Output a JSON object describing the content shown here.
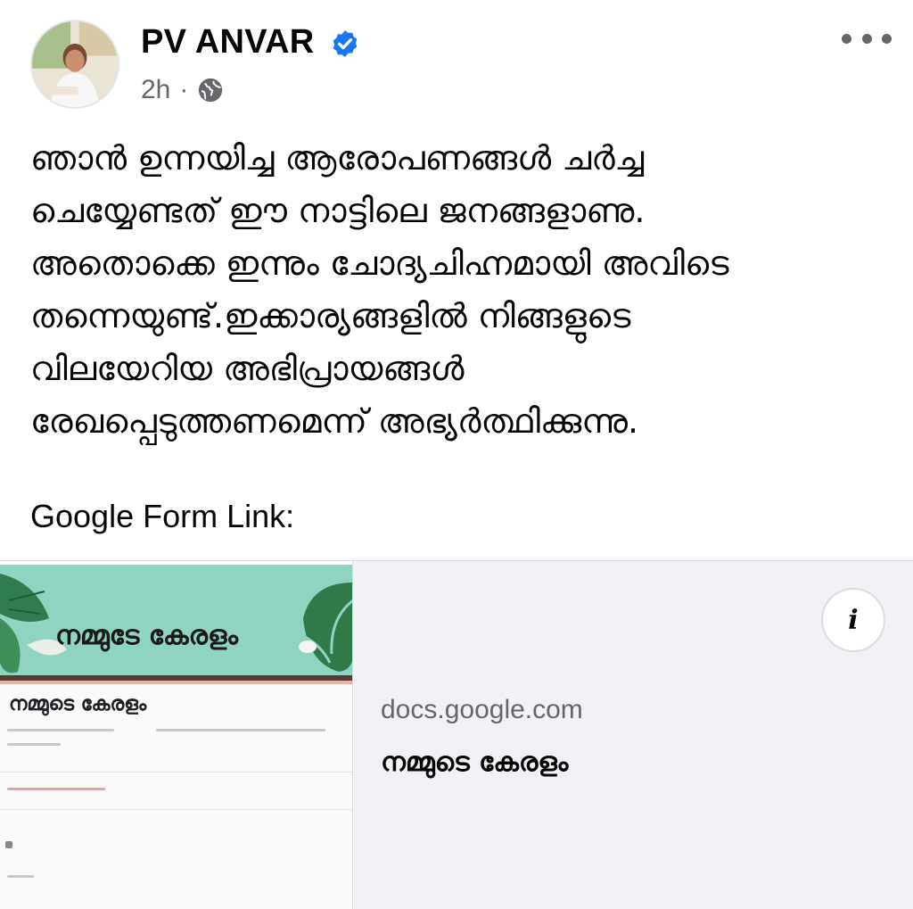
{
  "post": {
    "author": "PV ANVAR",
    "time": "2h",
    "separator": "·",
    "text_lines": [
      "ഞാൻ ഉന്നയിച്ച ആരോപണങ്ങൾ ചർച്ച",
      "ചെയ്യേണ്ടത് ഈ നാട്ടിലെ ജനങ്ങളാണു.",
      "അതൊക്കെ ഇന്നും ചോദ്യചിഹ്നമായി അവിടെ",
      "തന്നെയുണ്ട്.ഇക്കാര്യങ്ങളിൽ നിങ്ങളുടെ",
      "വിലയേറിയ അഭിപ്രായങ്ങൾ",
      "രേഖപ്പെടുത്തണമെന്ന് അഭ്യർത്ഥിക്കുന്നു."
    ],
    "form_label": "Google Form Link:"
  },
  "link_preview": {
    "image_banner_title": "നമ്മുടേ കേരളം",
    "image_form_heading": "നമ്മുടെ കേരളം",
    "info_symbol": "i",
    "domain": "docs.google.com",
    "title": "നമ്മുടെ കേരളം"
  },
  "colors": {
    "verified": "#1877f2",
    "secondary_text": "#65676b",
    "card_bg": "#f0f2f5",
    "banner": "#8fd3c1"
  },
  "icons": {
    "verified": "verified-badge-icon",
    "audience": "globe-icon",
    "more": "more-options-icon",
    "info": "info-icon"
  }
}
